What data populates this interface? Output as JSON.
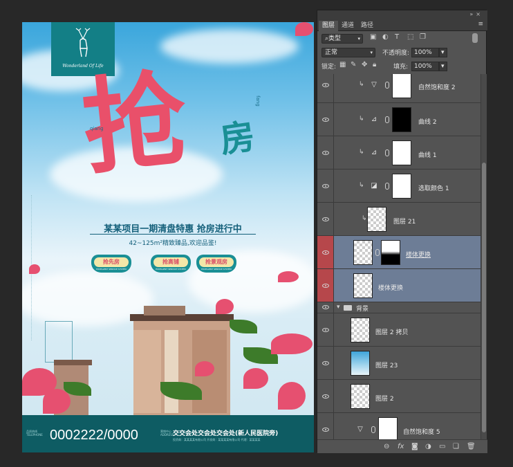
{
  "poster": {
    "logo_text": "Wonderland Of Life",
    "title_main": "抢",
    "title_second": "房",
    "pinyin_left": "qiang",
    "pinyin_right": "fang",
    "subtitle": "某某项目一期清盘特惠 抢房进行中",
    "subtext": "42~125m²精致臻品,欢迎品鉴!",
    "tags": [
      {
        "label": "抢先房",
        "tiny": "EXCELLENT SERVICE SYSTEM"
      },
      {
        "label": "抢高铺",
        "tiny": "EXCELLENT SERVICE SYSTEM"
      },
      {
        "label": "抢景观房",
        "tiny": "EXCELLENT SERVICE SYSTEM"
      }
    ],
    "phone_label": "品质热线\nTELEPHONE",
    "phone": "0002222/0000",
    "addr_label": "营销中心\nADDRESS",
    "addr": "交交会处交会处交会处(新人民医院旁)",
    "addr_small": "投资商：某某某某有限公司  开发商：某某某某有限公司  代理：某某某某"
  },
  "panel": {
    "tabs": [
      "图层",
      "通道",
      "路径"
    ],
    "active_tab": 0,
    "filter_kind": "类型",
    "blend_mode": "正常",
    "opacity_label": "不透明度:",
    "opacity_value": "100%",
    "lock_label": "锁定:",
    "fill_label": "填充:",
    "fill_value": "100%",
    "layers": [
      {
        "name": "自然饱和度 2",
        "type": "adjustment",
        "icon": "vibrance-icon",
        "clip": true,
        "mask": "white",
        "selected": false
      },
      {
        "name": "曲线 2",
        "type": "adjustment",
        "icon": "curves-icon",
        "clip": true,
        "mask": "black",
        "selected": false
      },
      {
        "name": "曲线 1",
        "type": "adjustment",
        "icon": "curves-icon",
        "clip": true,
        "mask": "white",
        "selected": false
      },
      {
        "name": "选取颜色 1",
        "type": "adjustment",
        "icon": "selective-color-icon",
        "clip": true,
        "mask": "white",
        "selected": false
      },
      {
        "name": "图层 21",
        "type": "pixel",
        "clip": true,
        "selected": false
      },
      {
        "name": "楼体更换",
        "type": "pixel-mask",
        "clip": false,
        "selected": true
      },
      {
        "name": "楼体更换",
        "type": "pixel",
        "clip": false,
        "selected": true
      }
    ],
    "group_name": "背景",
    "group_layers": [
      {
        "name": "图层 2 拷贝",
        "type": "pixel"
      },
      {
        "name": "图层 23",
        "type": "sky"
      },
      {
        "name": "图层 2",
        "type": "pixel"
      },
      {
        "name": "自然饱和度 5",
        "type": "adjustment",
        "icon": "vibrance-icon"
      }
    ],
    "bottom_icons": [
      "link-icon",
      "fx-icon",
      "mask-icon",
      "adjustment-icon",
      "folder-icon",
      "new-layer-icon",
      "trash-icon"
    ]
  }
}
